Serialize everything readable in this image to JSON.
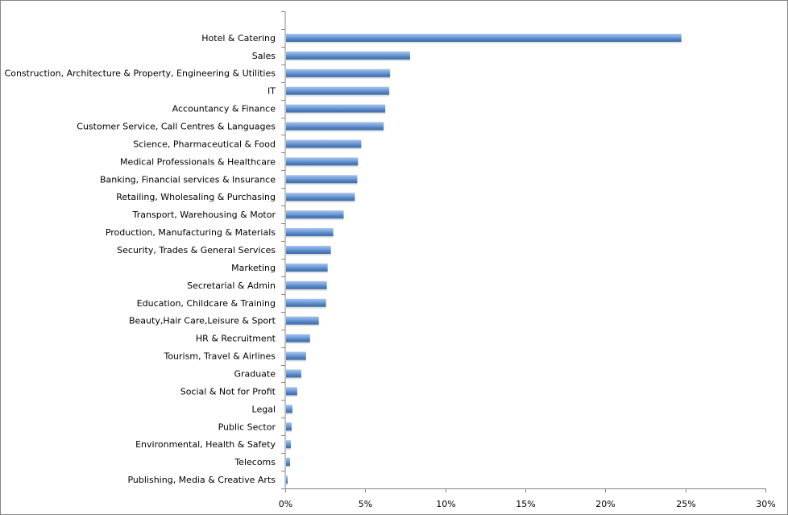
{
  "chart_data": {
    "type": "bar",
    "orientation": "horizontal",
    "title": "",
    "xlabel": "",
    "ylabel": "",
    "xlim": [
      0,
      30
    ],
    "x_tick_labels": [
      "0%",
      "5%",
      "10%",
      "15%",
      "20%",
      "25%",
      "30%"
    ],
    "x_ticks": [
      0,
      5,
      10,
      15,
      20,
      25,
      30
    ],
    "grid": false,
    "legend": "none",
    "bar_color": "#4F81BD",
    "bar_highlight_color": "#8DB3E2",
    "categories": [
      "Hotel & Catering",
      "Sales",
      "Construction, Architecture & Property, Engineering & Utilities",
      "IT",
      "Accountancy & Finance",
      "Customer Service, Call Centres & Languages",
      "Science, Pharmaceutical & Food",
      "Medical Professionals & Healthcare",
      "Banking, Financial services & Insurance",
      "Retailing, Wholesaling & Purchasing",
      "Transport, Warehousing & Motor",
      "Production, Manufacturing & Materials",
      "Security, Trades & General Services",
      "Marketing",
      "Secretarial & Admin",
      "Education, Childcare & Training",
      "Beauty,Hair Care,Leisure & Sport",
      "HR & Recruitment",
      "Tourism, Travel & Airlines",
      "Graduate",
      "Social & Not for Profit",
      "Legal",
      "Public Sector",
      "Environmental, Health & Safety",
      "Telecoms",
      "Publishing, Media & Creative Arts"
    ],
    "values": [
      24.7,
      7.75,
      6.5,
      6.45,
      6.2,
      6.1,
      4.7,
      4.5,
      4.45,
      4.3,
      3.6,
      2.95,
      2.8,
      2.6,
      2.55,
      2.5,
      2.05,
      1.5,
      1.25,
      0.95,
      0.7,
      0.4,
      0.35,
      0.3,
      0.25,
      0.1
    ],
    "unit": "%"
  }
}
